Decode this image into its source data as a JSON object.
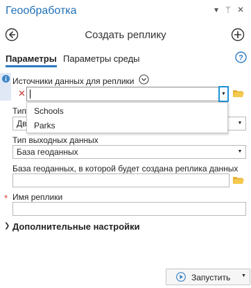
{
  "window": {
    "title": "Геообработка",
    "menu_glyph": "▾",
    "pin_glyph": "ᛘ",
    "close_glyph": "✕"
  },
  "nav": {
    "title": "Создать реплику"
  },
  "tabs": [
    {
      "label": "Параметры",
      "active": true
    },
    {
      "label": "Параметры среды",
      "active": false
    }
  ],
  "params": {
    "data_sources": {
      "label": "Источники данных для реплики",
      "value": "",
      "dropdown_options": [
        "Schools",
        "Parks"
      ]
    },
    "replica_type": {
      "label_partial": "Тип",
      "value_partial": "Дв"
    },
    "output_type": {
      "label": "Тип выходных данных",
      "value": "База геоданных"
    },
    "geodatabase": {
      "label": "База геоданных, в которой будет создана реплика данных",
      "value": ""
    },
    "replica_name": {
      "label": "Имя реплики",
      "required_marker": "*",
      "value": ""
    },
    "advanced": {
      "label": "Дополнительные настройки"
    }
  },
  "run_button": {
    "label": "Запустить"
  },
  "colors": {
    "accent": "#1f6fb5",
    "tab_underline": "#2b79c2",
    "required": "#d9342b",
    "remove_x": "#c0392b",
    "folder": "#e8b030"
  }
}
